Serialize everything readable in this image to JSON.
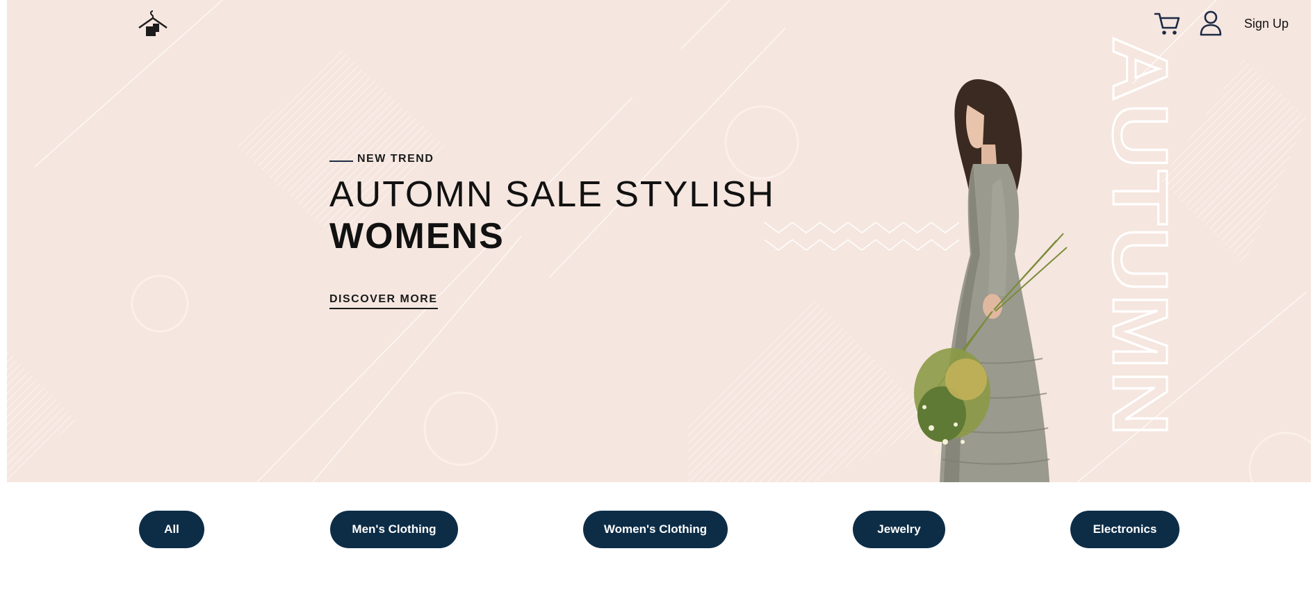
{
  "nav": {
    "logo_icon": "hanger-icon",
    "cart_icon": "cart-icon",
    "user_icon": "user-icon",
    "signup_label": "Sign Up"
  },
  "hero": {
    "eyebrow": "NEW TREND",
    "headline_line1": "AUTOMN SALE STYLISH",
    "headline_line2": "WOMENS",
    "cta_label": "DISCOVER MORE",
    "side_word": "AUTUMN",
    "background_color": "#f5e6df"
  },
  "categories": [
    {
      "label": "All"
    },
    {
      "label": "Men's Clothing"
    },
    {
      "label": "Women's Clothing"
    },
    {
      "label": "Jewelry"
    },
    {
      "label": "Electronics"
    }
  ],
  "colors": {
    "accent": "#0d2d47",
    "text": "#111111"
  }
}
